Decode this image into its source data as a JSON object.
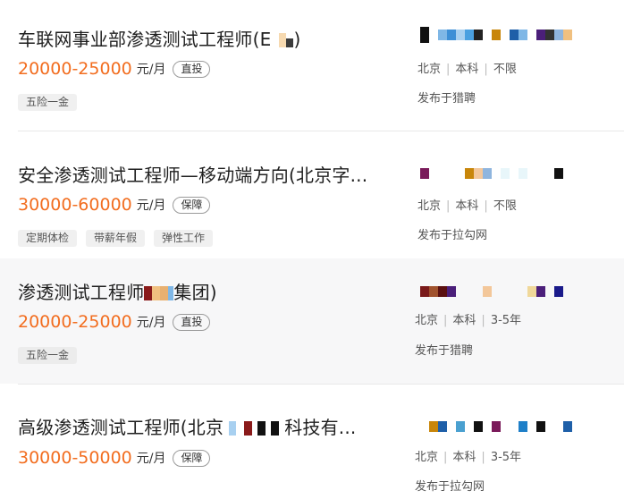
{
  "jobs": [
    {
      "title": "车联网事业部渗透测试工程师(E",
      "title_suffix": ")",
      "salary": "20000-25000",
      "unit": "元/月",
      "badge": "直投",
      "tags": [
        "五险一金"
      ],
      "location": "北京",
      "education": "本科",
      "experience": "不限",
      "source": "发布于猎聘"
    },
    {
      "title": "安全渗透测试工程师—移动端方向(北京字...",
      "salary": "30000-60000",
      "unit": "元/月",
      "badge": "保障",
      "tags": [
        "定期体检",
        "带薪年假",
        "弹性工作"
      ],
      "location": "北京",
      "education": "本科",
      "experience": "不限",
      "source": "发布于拉勾网"
    },
    {
      "title": "渗透测试工程师",
      "title_suffix": "集团)",
      "salary": "20000-25000",
      "unit": "元/月",
      "badge": "直投",
      "tags": [
        "五险一金"
      ],
      "location": "北京",
      "education": "本科",
      "experience": "3-5年",
      "source": "发布于猎聘"
    },
    {
      "title": "高级渗透测试工程师(北京",
      "title_suffix": "科技有...",
      "salary": "30000-50000",
      "unit": "元/月",
      "badge": "保障",
      "tags": [],
      "location": "北京",
      "education": "本科",
      "experience": "3-5年",
      "source": "发布于拉勾网"
    }
  ],
  "colors": {
    "salary": "#f26d1f",
    "highlight_row": "#f7f7f8"
  }
}
